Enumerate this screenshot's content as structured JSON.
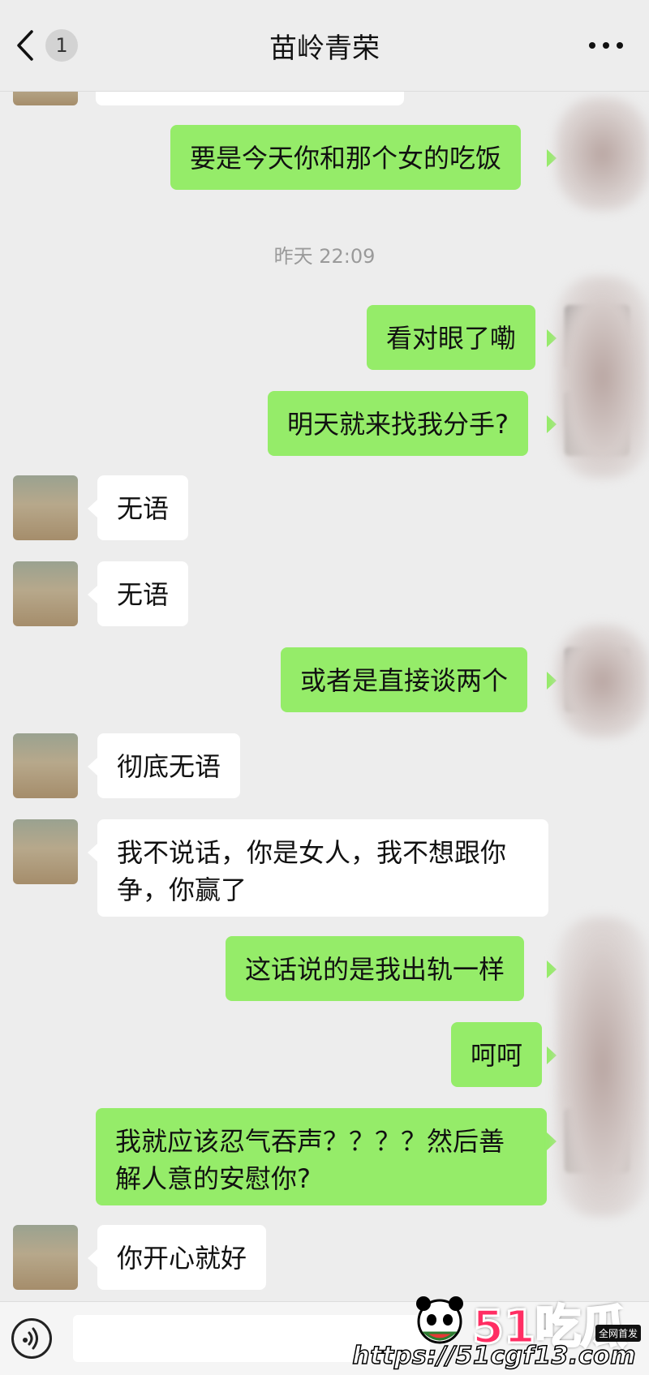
{
  "header": {
    "back_badge": "1",
    "title": "苗岭青荣",
    "more_icon": "more-dots-icon"
  },
  "timestamp": "昨天 22:09",
  "messages": [
    {
      "side": "send",
      "text": "要是今天你和那个女的吃饭"
    },
    {
      "side": "send",
      "text": "看对眼了嘞"
    },
    {
      "side": "send",
      "text": "明天就来找我分手?"
    },
    {
      "side": "recv",
      "text": "无语"
    },
    {
      "side": "recv",
      "text": "无语"
    },
    {
      "side": "send",
      "text": "或者是直接谈两个"
    },
    {
      "side": "recv",
      "text": "彻底无语"
    },
    {
      "side": "recv",
      "text_line1": "我不说话，你是女人，我不想跟你",
      "text_line2": "争，你赢了"
    },
    {
      "side": "send",
      "text": "这话说的是我出轨一样"
    },
    {
      "side": "send",
      "text": "呵呵"
    },
    {
      "side": "send",
      "text_line1": "我就应该忍气吞声？？？？然后善",
      "text_line2": "解人意的安慰你?"
    },
    {
      "side": "recv",
      "text": "你开心就好"
    }
  ],
  "footer": {
    "voice_icon": "voice-input-icon"
  },
  "watermark": {
    "logo": "51吃瓜",
    "url": "https://51cgf13.com",
    "tag": "全网首发"
  },
  "colors": {
    "background": "#ededed",
    "sent_bubble": "#95ec69",
    "received_bubble": "#ffffff",
    "timestamp": "#9a9a9a"
  }
}
